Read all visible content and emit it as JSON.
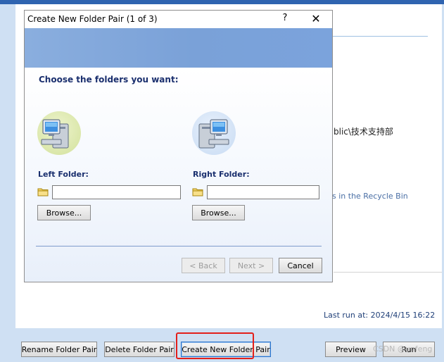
{
  "background": {
    "partial_text_public": "blic\\技术支持部",
    "partial_text_recycle": "s in the Recycle Bin",
    "last_run": "Last run at: 2024/4/15 16:22",
    "bottom_buttons": {
      "rename": "Rename Folder Pair",
      "delete": "Delete Folder Pair",
      "create": "Create New Folder Pair",
      "preview": "Preview",
      "run": "Run"
    },
    "watermark": "CSDN @unfeng",
    "highlight_color": "#e3201b"
  },
  "dialog": {
    "title": "Create New Folder Pair (1 of 3)",
    "help_glyph": "?",
    "close_glyph": "✕",
    "heading": "Choose the folders you want:",
    "left": {
      "label": "Left Folder:",
      "value": "",
      "browse": "Browse..."
    },
    "right": {
      "label": "Right Folder:",
      "value": "",
      "browse": "Browse..."
    },
    "buttons": {
      "back": "< Back",
      "next": "Next >",
      "cancel": "Cancel"
    },
    "icons": {
      "left_computer": "computer-icon",
      "right_computer": "computer-icon",
      "folder": "folder-icon"
    },
    "colors": {
      "banner": "#7aa1d8",
      "heading": "#1a2f6e",
      "left_circle": "#dde9b0",
      "right_circle": "#cfe0f5"
    }
  }
}
